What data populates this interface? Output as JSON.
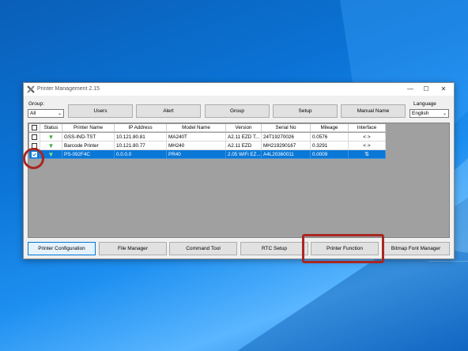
{
  "window": {
    "title": "Printer Management 2.15"
  },
  "controls": {
    "group_label": "Group:",
    "group_value": "All",
    "language_label": "Language",
    "language_value": "English"
  },
  "top_buttons": {
    "users": "Users",
    "alert": "Alert",
    "group": "Group",
    "setup": "Setup",
    "manual_name": "Manual Name"
  },
  "table": {
    "headers": [
      "Status",
      "Printer Name",
      "IP Address",
      "Model Name",
      "Version",
      "Serial No",
      "Mileage",
      "Interface"
    ],
    "rows": [
      {
        "name": "GSS-IND-TST",
        "ip": "10.121.80.81",
        "model": "MA240T",
        "version": "A2.11 EZD T...",
        "serial": "24T19270026",
        "mileage": "0.0576",
        "interface": "<·>"
      },
      {
        "name": "Barcode Printer",
        "ip": "10.121.80.77",
        "model": "MH240",
        "version": "A2.11 EZD",
        "serial": "MH219290167",
        "mileage": "0.3291",
        "interface": "<·>"
      },
      {
        "name": "PS-092F4C",
        "ip": "0.0.0.0",
        "model": "PR40",
        "version": "2.05 WiFi EZ...",
        "serial": "A4L20360011",
        "mileage": "0.0009",
        "interface": "USB"
      }
    ]
  },
  "bottom_buttons": {
    "printer_configuration": "Printer Configuration",
    "file_manager": "File Manager",
    "command_tool": "Command Tool",
    "rtc_setup": "RTC Setup",
    "printer_function": "Printer Function",
    "bitmap_font_manager": "Bitmap Font Manager"
  },
  "colors": {
    "selection": "#0a78d7",
    "highlight": "#a92621",
    "status_icon": "#3cb043"
  }
}
